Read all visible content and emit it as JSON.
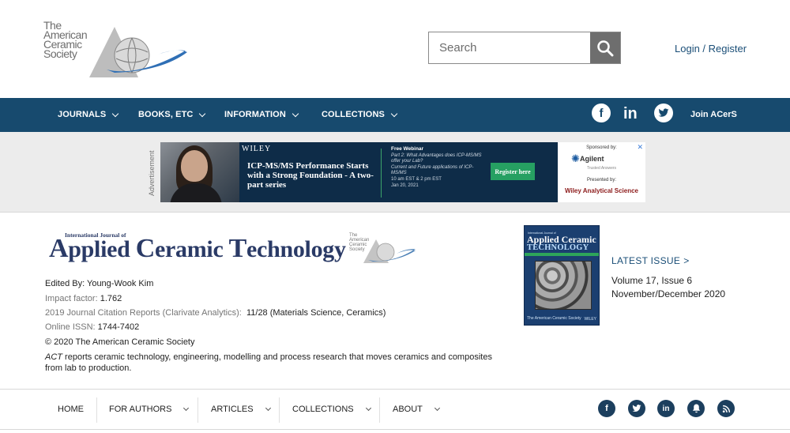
{
  "header": {
    "logo_lines": [
      "The",
      "American",
      "Ceramic",
      "Society"
    ],
    "search_placeholder": "Search",
    "login_label": "Login",
    "login_sep": " / ",
    "register_label": "Register"
  },
  "nav": {
    "items": [
      {
        "label": "JOURNALS"
      },
      {
        "label": "BOOKS, ETC"
      },
      {
        "label": "INFORMATION"
      },
      {
        "label": "COLLECTIONS"
      }
    ],
    "linkedin_text": "in",
    "join_label": "Join ACerS"
  },
  "ad": {
    "label": "Advertisement",
    "brand": "WILEY",
    "title": "ICP-MS/MS Performance Starts with a Strong Foundation - A two-part series",
    "webinar_heading": "Free Webinar",
    "webinar_part": "Part 2: What Advantages does ICP-MS/MS offer your Lab?",
    "webinar_topic": "Current and Future applications of ICP-MS/MS",
    "webinar_time": "10 am EST & 2 pm EST",
    "webinar_date": "Jan 20, 2021",
    "cta": "Register here",
    "sponsored_by": "Sponsored by:",
    "sponsor": "Agilent",
    "sponsor_tagline": "Trusted Answers",
    "presented_by": "Presented by:",
    "presenter": "Wiley Analytical Science"
  },
  "journal": {
    "logo_small": "International Journal of",
    "logo_main_parts": [
      "A",
      "pplied ",
      "C",
      "eramic ",
      "T",
      "echnology"
    ],
    "logo_society": [
      "The",
      "American",
      "Ceramic",
      "Society"
    ],
    "edited_by": "Edited By: Young-Wook Kim",
    "impact_label": "Impact factor:",
    "impact_value": "1.762",
    "jcr_label": "2019 Journal Citation Reports (Clarivate Analytics):",
    "jcr_value": "11/28 (Materials Science, Ceramics)",
    "issn_label": "Online ISSN:",
    "issn_value": "1744-7402",
    "copyright": "© 2020 The American Ceramic Society",
    "desc_abbr": "ACT",
    "desc_rest": " reports ceramic technology, engineering, modelling and process research that moves ceramics and composites from lab to production.",
    "cover": {
      "top": "International Journal of",
      "line1": "Applied Ceramic",
      "line2": "TECHNOLOGY",
      "left_mark": "The American Ceramic Society",
      "right_mark": "WILEY"
    },
    "latest_label": "LATEST ISSUE",
    "latest_arrow": ">",
    "volume": "Volume 17, Issue 6",
    "period": "November/December 2020"
  },
  "bottom_nav": {
    "items": [
      {
        "label": "HOME"
      },
      {
        "label": "FOR AUTHORS"
      },
      {
        "label": "ARTICLES"
      },
      {
        "label": "COLLECTIONS"
      },
      {
        "label": "ABOUT"
      }
    ],
    "social": [
      {
        "name": "facebook-icon",
        "glyph": "f"
      },
      {
        "name": "twitter-icon",
        "glyph": "t"
      },
      {
        "name": "linkedin-icon",
        "glyph": "in"
      },
      {
        "name": "bell-icon",
        "glyph": "🔔"
      },
      {
        "name": "rss-icon",
        "glyph": "◉"
      }
    ]
  },
  "colors": {
    "nav_bg": "#174a6e",
    "link": "#1a4e77",
    "journal_navy": "#2a3a66",
    "social_dark": "#1c3f5e"
  }
}
